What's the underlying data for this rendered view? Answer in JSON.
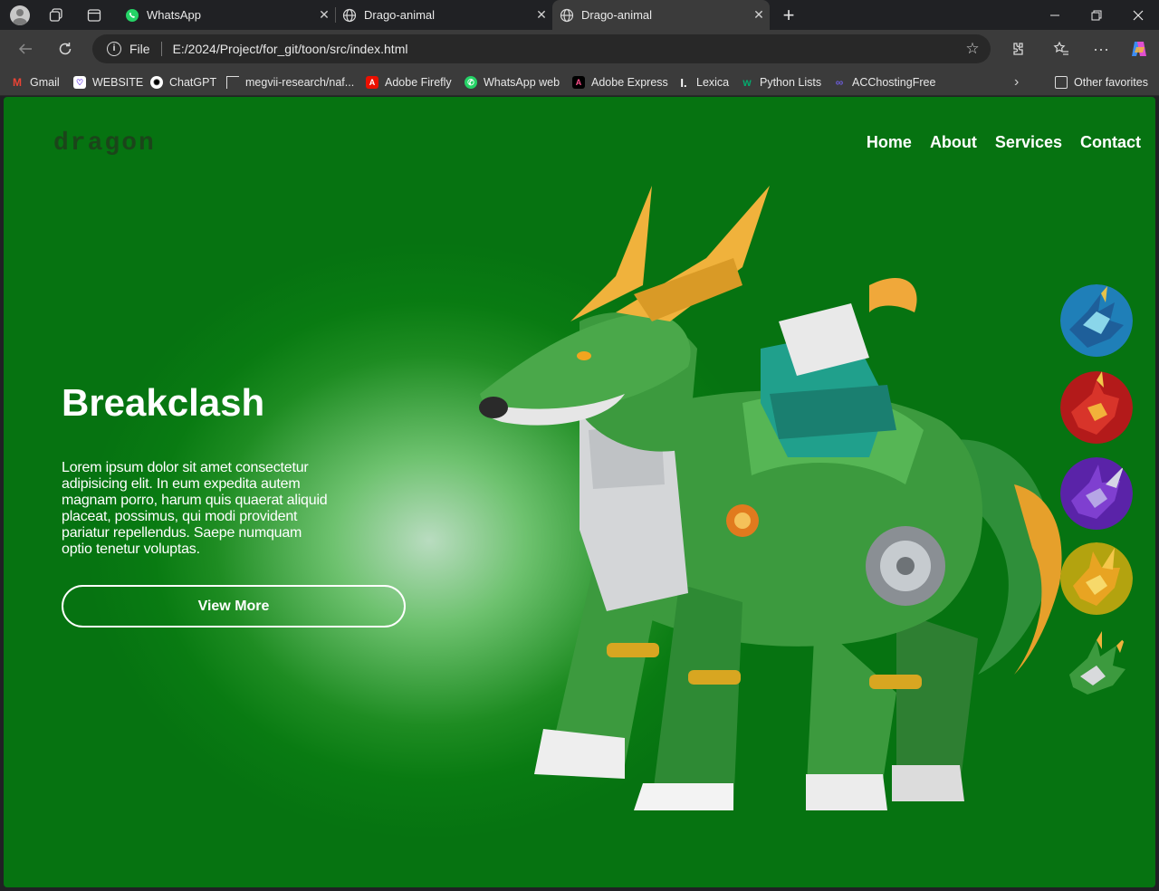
{
  "browser": {
    "tabs": [
      {
        "title": "WhatsApp",
        "icon": "whatsapp-icon"
      },
      {
        "title": "Drago-animal",
        "icon": "globe-icon"
      },
      {
        "title": "Drago-animal",
        "icon": "globe-icon",
        "active": true
      }
    ],
    "address": {
      "scheme": "File",
      "url": "E:/2024/Project/for_git/toon/src/index.html"
    },
    "bookmarks": [
      {
        "label": "Gmail",
        "icon": "gmail-icon"
      },
      {
        "label": "WEBSITE",
        "icon": "website-icon"
      },
      {
        "label": "ChatGPT",
        "icon": "chatgpt-icon"
      },
      {
        "label": "megvii-research/naf...",
        "icon": "github-icon"
      },
      {
        "label": "Adobe Firefly",
        "icon": "adobe-icon"
      },
      {
        "label": "WhatsApp web",
        "icon": "whatsapp-icon"
      },
      {
        "label": "Adobe Express",
        "icon": "adobe-express-icon"
      },
      {
        "label": "Lexica",
        "icon": "lexica-icon"
      },
      {
        "label": "Python Lists",
        "icon": "w3schools-icon"
      },
      {
        "label": "ACChostingFree",
        "icon": "hosting-icon"
      }
    ],
    "other_favorites": "Other favorites"
  },
  "page": {
    "logo": "dragon",
    "nav": [
      "Home",
      "About",
      "Services",
      "Contact"
    ],
    "hero": {
      "title": "Breakclash",
      "text": "Lorem ipsum dolor sit amet consectetur adipisicing elit. In eum expedita autem magnam porro, harum quis quaerat aliquid placeat, possimus, qui modi provident pariatur repellendus. Saepe numquam optio tenetur voluptas.",
      "button": "View More"
    },
    "thumbnails": [
      "blue-dragon",
      "red-dragon",
      "purple-dragon",
      "yellow-dragon",
      "green-dragon"
    ]
  },
  "colors": {
    "page_green": "#097b12",
    "glow": "#b9dcc0",
    "chrome_dark": "#202124",
    "chrome_toolbar": "#3b3b3b"
  }
}
